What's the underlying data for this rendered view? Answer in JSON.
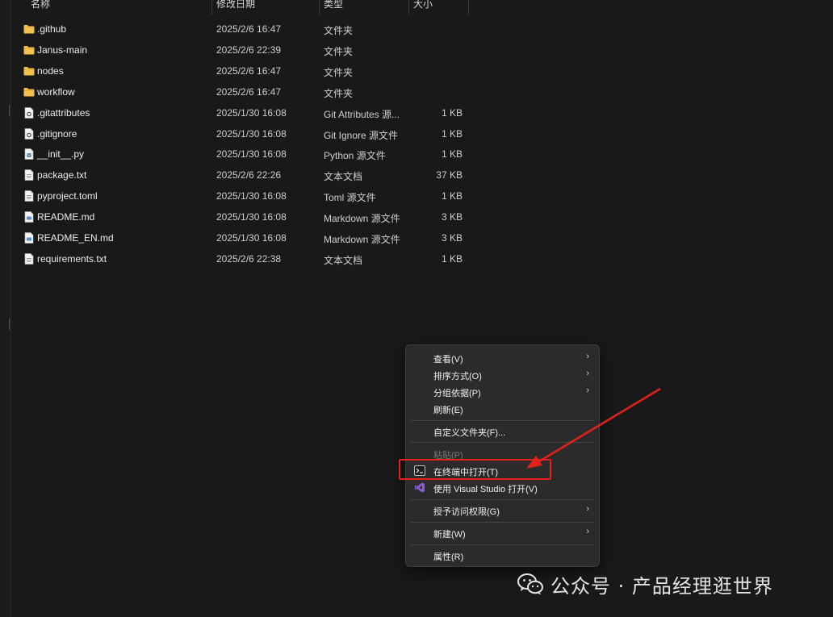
{
  "columns": {
    "name": "名称",
    "modified": "修改日期",
    "type": "类型",
    "size": "大小"
  },
  "files": [
    {
      "name": ".github",
      "date": "2025/2/6 16:47",
      "type": "文件夹",
      "size": "",
      "icon": "folder-icon"
    },
    {
      "name": "Janus-main",
      "date": "2025/2/6 22:39",
      "type": "文件夹",
      "size": "",
      "icon": "folder-icon"
    },
    {
      "name": "nodes",
      "date": "2025/2/6 16:47",
      "type": "文件夹",
      "size": "",
      "icon": "folder-icon"
    },
    {
      "name": "workflow",
      "date": "2025/2/6 16:47",
      "type": "文件夹",
      "size": "",
      "icon": "folder-icon"
    },
    {
      "name": ".gitattributes",
      "date": "2025/1/30 16:08",
      "type": "Git Attributes 源...",
      "size": "1 KB",
      "icon": "config-file-icon"
    },
    {
      "name": ".gitignore",
      "date": "2025/1/30 16:08",
      "type": "Git Ignore 源文件",
      "size": "1 KB",
      "icon": "config-file-icon"
    },
    {
      "name": "__init__.py",
      "date": "2025/1/30 16:08",
      "type": "Python 源文件",
      "size": "1 KB",
      "icon": "python-file-icon"
    },
    {
      "name": "package.txt",
      "date": "2025/2/6 22:26",
      "type": "文本文档",
      "size": "37 KB",
      "icon": "text-file-icon"
    },
    {
      "name": "pyproject.toml",
      "date": "2025/1/30 16:08",
      "type": "Toml 源文件",
      "size": "1 KB",
      "icon": "text-file-icon"
    },
    {
      "name": "README.md",
      "date": "2025/1/30 16:08",
      "type": "Markdown 源文件",
      "size": "3 KB",
      "icon": "markdown-file-icon"
    },
    {
      "name": "README_EN.md",
      "date": "2025/1/30 16:08",
      "type": "Markdown 源文件",
      "size": "3 KB",
      "icon": "markdown-file-icon"
    },
    {
      "name": "requirements.txt",
      "date": "2025/2/6 22:38",
      "type": "文本文档",
      "size": "1 KB",
      "icon": "text-file-icon"
    }
  ],
  "context_menu": {
    "view": "查看(V)",
    "sort": "排序方式(O)",
    "group": "分组依据(P)",
    "refresh": "刷新(E)",
    "customize": "自定义文件夹(F)...",
    "paste": "粘贴(P)",
    "open_terminal": "在终端中打开(T)",
    "open_vs": "使用 Visual Studio 打开(V)",
    "grant_access": "授予访问权限(G)",
    "new": "新建(W)",
    "properties": "属性(R)"
  },
  "annotation": {
    "color": "#e3201b"
  },
  "watermark": {
    "text": "公众号 · 产品经理逛世界"
  },
  "colors": {
    "background": "#191919",
    "folder": "#f2c14e",
    "menu_bg": "#2b2b2b",
    "vs_purple": "#8a5cd8"
  }
}
